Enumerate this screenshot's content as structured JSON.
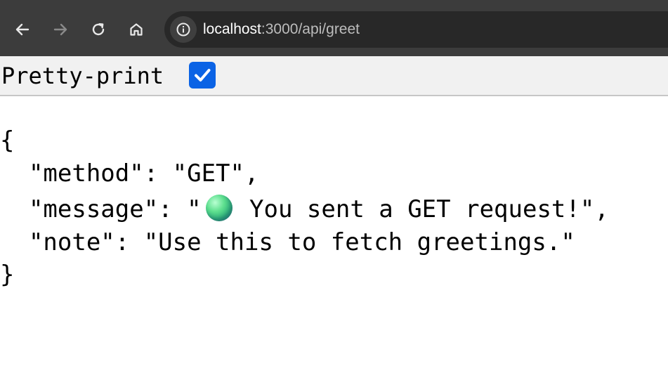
{
  "browser": {
    "url_host": "localhost",
    "url_path": ":3000/api/greet",
    "icons": {
      "back": "arrow-left-icon",
      "forward": "arrow-right-icon",
      "reload": "reload-icon",
      "home": "home-icon",
      "site_info": "info-icon"
    }
  },
  "viewer": {
    "pretty_print_label": "Pretty-print",
    "pretty_print_checked": true,
    "checkbox_color": "#0b63e5"
  },
  "json": {
    "open_brace": "{",
    "line_method": "  \"method\": \"GET\",",
    "line_message_prefix": "  \"message\": \"",
    "line_message_suffix": " You sent a GET request!\",",
    "line_note": "  \"note\": \"Use this to fetch greetings.\"",
    "close_brace": "}",
    "emoji": "green-orb-emoji"
  }
}
